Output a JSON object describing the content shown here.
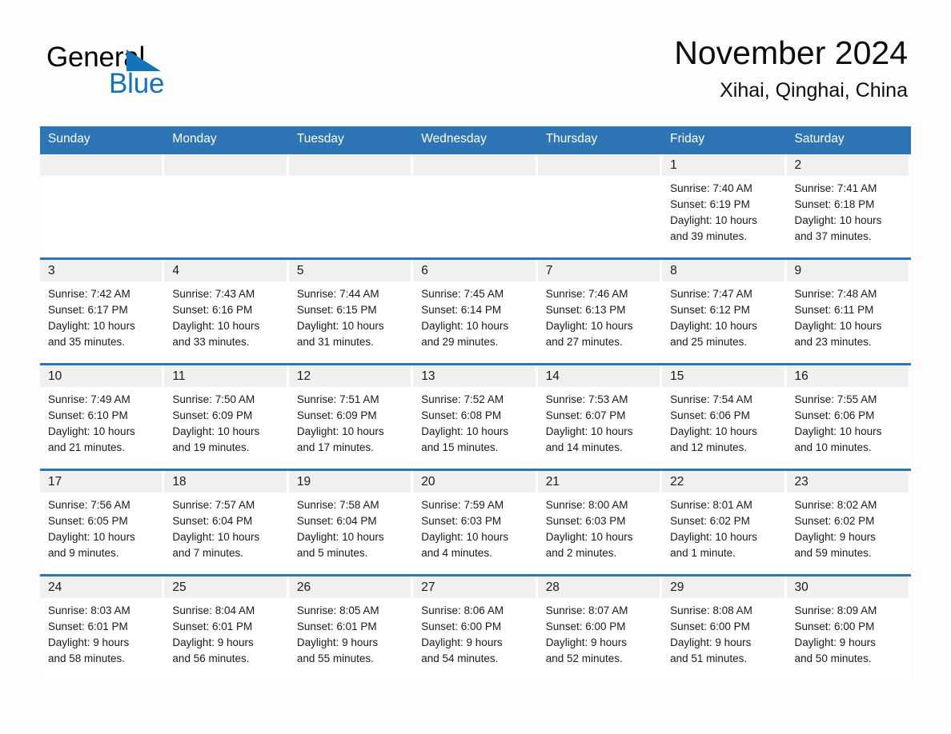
{
  "brand": {
    "name_part1": "General",
    "name_part2": "Blue",
    "accent_color": "#1573ba"
  },
  "header": {
    "title": "November 2024",
    "location": "Xihai, Qinghai, China"
  },
  "theme": {
    "header_row_color": "#2e75b6",
    "day_band_color": "#f0f0f0",
    "page_background": "#fdfdfd"
  },
  "weekdays": [
    "Sunday",
    "Monday",
    "Tuesday",
    "Wednesday",
    "Thursday",
    "Friday",
    "Saturday"
  ],
  "weeks": [
    [
      {
        "day": "",
        "sunrise": "",
        "sunset": "",
        "daylight_line1": "",
        "daylight_line2": ""
      },
      {
        "day": "",
        "sunrise": "",
        "sunset": "",
        "daylight_line1": "",
        "daylight_line2": ""
      },
      {
        "day": "",
        "sunrise": "",
        "sunset": "",
        "daylight_line1": "",
        "daylight_line2": ""
      },
      {
        "day": "",
        "sunrise": "",
        "sunset": "",
        "daylight_line1": "",
        "daylight_line2": ""
      },
      {
        "day": "",
        "sunrise": "",
        "sunset": "",
        "daylight_line1": "",
        "daylight_line2": ""
      },
      {
        "day": "1",
        "sunrise": "Sunrise: 7:40 AM",
        "sunset": "Sunset: 6:19 PM",
        "daylight_line1": "Daylight: 10 hours",
        "daylight_line2": "and 39 minutes."
      },
      {
        "day": "2",
        "sunrise": "Sunrise: 7:41 AM",
        "sunset": "Sunset: 6:18 PM",
        "daylight_line1": "Daylight: 10 hours",
        "daylight_line2": "and 37 minutes."
      }
    ],
    [
      {
        "day": "3",
        "sunrise": "Sunrise: 7:42 AM",
        "sunset": "Sunset: 6:17 PM",
        "daylight_line1": "Daylight: 10 hours",
        "daylight_line2": "and 35 minutes."
      },
      {
        "day": "4",
        "sunrise": "Sunrise: 7:43 AM",
        "sunset": "Sunset: 6:16 PM",
        "daylight_line1": "Daylight: 10 hours",
        "daylight_line2": "and 33 minutes."
      },
      {
        "day": "5",
        "sunrise": "Sunrise: 7:44 AM",
        "sunset": "Sunset: 6:15 PM",
        "daylight_line1": "Daylight: 10 hours",
        "daylight_line2": "and 31 minutes."
      },
      {
        "day": "6",
        "sunrise": "Sunrise: 7:45 AM",
        "sunset": "Sunset: 6:14 PM",
        "daylight_line1": "Daylight: 10 hours",
        "daylight_line2": "and 29 minutes."
      },
      {
        "day": "7",
        "sunrise": "Sunrise: 7:46 AM",
        "sunset": "Sunset: 6:13 PM",
        "daylight_line1": "Daylight: 10 hours",
        "daylight_line2": "and 27 minutes."
      },
      {
        "day": "8",
        "sunrise": "Sunrise: 7:47 AM",
        "sunset": "Sunset: 6:12 PM",
        "daylight_line1": "Daylight: 10 hours",
        "daylight_line2": "and 25 minutes."
      },
      {
        "day": "9",
        "sunrise": "Sunrise: 7:48 AM",
        "sunset": "Sunset: 6:11 PM",
        "daylight_line1": "Daylight: 10 hours",
        "daylight_line2": "and 23 minutes."
      }
    ],
    [
      {
        "day": "10",
        "sunrise": "Sunrise: 7:49 AM",
        "sunset": "Sunset: 6:10 PM",
        "daylight_line1": "Daylight: 10 hours",
        "daylight_line2": "and 21 minutes."
      },
      {
        "day": "11",
        "sunrise": "Sunrise: 7:50 AM",
        "sunset": "Sunset: 6:09 PM",
        "daylight_line1": "Daylight: 10 hours",
        "daylight_line2": "and 19 minutes."
      },
      {
        "day": "12",
        "sunrise": "Sunrise: 7:51 AM",
        "sunset": "Sunset: 6:09 PM",
        "daylight_line1": "Daylight: 10 hours",
        "daylight_line2": "and 17 minutes."
      },
      {
        "day": "13",
        "sunrise": "Sunrise: 7:52 AM",
        "sunset": "Sunset: 6:08 PM",
        "daylight_line1": "Daylight: 10 hours",
        "daylight_line2": "and 15 minutes."
      },
      {
        "day": "14",
        "sunrise": "Sunrise: 7:53 AM",
        "sunset": "Sunset: 6:07 PM",
        "daylight_line1": "Daylight: 10 hours",
        "daylight_line2": "and 14 minutes."
      },
      {
        "day": "15",
        "sunrise": "Sunrise: 7:54 AM",
        "sunset": "Sunset: 6:06 PM",
        "daylight_line1": "Daylight: 10 hours",
        "daylight_line2": "and 12 minutes."
      },
      {
        "day": "16",
        "sunrise": "Sunrise: 7:55 AM",
        "sunset": "Sunset: 6:06 PM",
        "daylight_line1": "Daylight: 10 hours",
        "daylight_line2": "and 10 minutes."
      }
    ],
    [
      {
        "day": "17",
        "sunrise": "Sunrise: 7:56 AM",
        "sunset": "Sunset: 6:05 PM",
        "daylight_line1": "Daylight: 10 hours",
        "daylight_line2": "and 9 minutes."
      },
      {
        "day": "18",
        "sunrise": "Sunrise: 7:57 AM",
        "sunset": "Sunset: 6:04 PM",
        "daylight_line1": "Daylight: 10 hours",
        "daylight_line2": "and 7 minutes."
      },
      {
        "day": "19",
        "sunrise": "Sunrise: 7:58 AM",
        "sunset": "Sunset: 6:04 PM",
        "daylight_line1": "Daylight: 10 hours",
        "daylight_line2": "and 5 minutes."
      },
      {
        "day": "20",
        "sunrise": "Sunrise: 7:59 AM",
        "sunset": "Sunset: 6:03 PM",
        "daylight_line1": "Daylight: 10 hours",
        "daylight_line2": "and 4 minutes."
      },
      {
        "day": "21",
        "sunrise": "Sunrise: 8:00 AM",
        "sunset": "Sunset: 6:03 PM",
        "daylight_line1": "Daylight: 10 hours",
        "daylight_line2": "and 2 minutes."
      },
      {
        "day": "22",
        "sunrise": "Sunrise: 8:01 AM",
        "sunset": "Sunset: 6:02 PM",
        "daylight_line1": "Daylight: 10 hours",
        "daylight_line2": "and 1 minute."
      },
      {
        "day": "23",
        "sunrise": "Sunrise: 8:02 AM",
        "sunset": "Sunset: 6:02 PM",
        "daylight_line1": "Daylight: 9 hours",
        "daylight_line2": "and 59 minutes."
      }
    ],
    [
      {
        "day": "24",
        "sunrise": "Sunrise: 8:03 AM",
        "sunset": "Sunset: 6:01 PM",
        "daylight_line1": "Daylight: 9 hours",
        "daylight_line2": "and 58 minutes."
      },
      {
        "day": "25",
        "sunrise": "Sunrise: 8:04 AM",
        "sunset": "Sunset: 6:01 PM",
        "daylight_line1": "Daylight: 9 hours",
        "daylight_line2": "and 56 minutes."
      },
      {
        "day": "26",
        "sunrise": "Sunrise: 8:05 AM",
        "sunset": "Sunset: 6:01 PM",
        "daylight_line1": "Daylight: 9 hours",
        "daylight_line2": "and 55 minutes."
      },
      {
        "day": "27",
        "sunrise": "Sunrise: 8:06 AM",
        "sunset": "Sunset: 6:00 PM",
        "daylight_line1": "Daylight: 9 hours",
        "daylight_line2": "and 54 minutes."
      },
      {
        "day": "28",
        "sunrise": "Sunrise: 8:07 AM",
        "sunset": "Sunset: 6:00 PM",
        "daylight_line1": "Daylight: 9 hours",
        "daylight_line2": "and 52 minutes."
      },
      {
        "day": "29",
        "sunrise": "Sunrise: 8:08 AM",
        "sunset": "Sunset: 6:00 PM",
        "daylight_line1": "Daylight: 9 hours",
        "daylight_line2": "and 51 minutes."
      },
      {
        "day": "30",
        "sunrise": "Sunrise: 8:09 AM",
        "sunset": "Sunset: 6:00 PM",
        "daylight_line1": "Daylight: 9 hours",
        "daylight_line2": "and 50 minutes."
      }
    ]
  ]
}
